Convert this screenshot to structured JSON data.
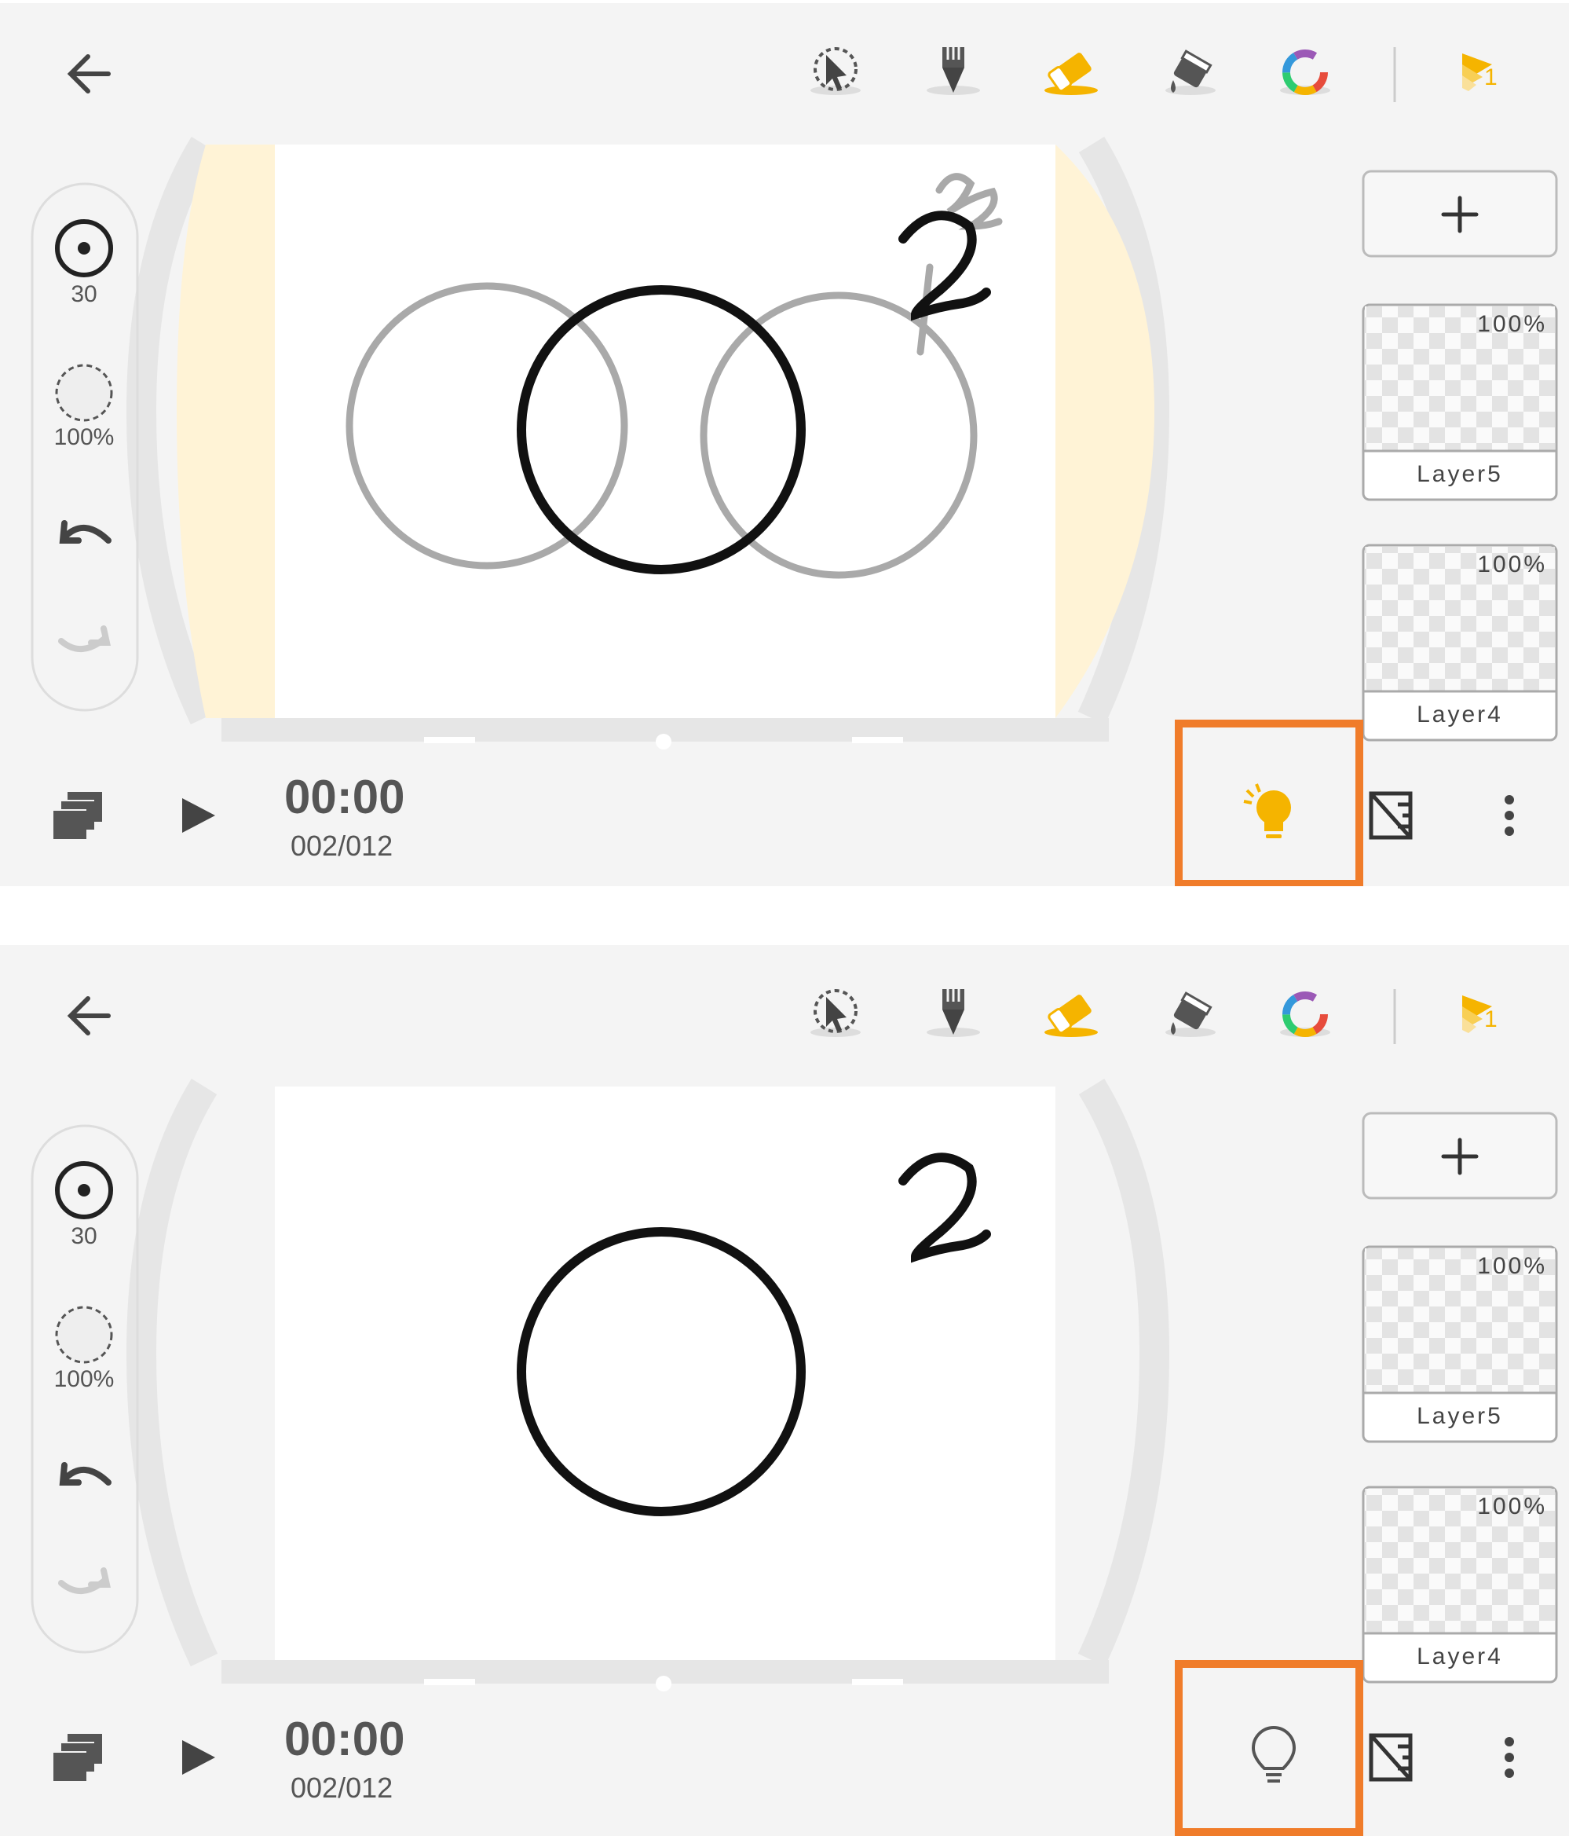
{
  "panels": [
    {
      "id": "top",
      "sidebar": {
        "brush_size": "30",
        "opacity": "100%"
      },
      "layers": [
        {
          "name": "Layer5",
          "opacity": "100%"
        },
        {
          "name": "Layer4",
          "opacity": "100%"
        }
      ],
      "timeline": {
        "time": "00:00",
        "frame": "002/012"
      },
      "onion_skin": {
        "state": "on",
        "color": "#f5b400"
      },
      "layer_badge": "1"
    },
    {
      "id": "bottom",
      "sidebar": {
        "brush_size": "30",
        "opacity": "100%"
      },
      "layers": [
        {
          "name": "Layer5",
          "opacity": "100%"
        },
        {
          "name": "Layer4",
          "opacity": "100%"
        }
      ],
      "timeline": {
        "time": "00:00",
        "frame": "002/012"
      },
      "onion_skin": {
        "state": "off",
        "color": "#555555"
      },
      "layer_badge": "1"
    }
  ],
  "colors": {
    "accent": "#f5b400",
    "highlight": "#f07c2a",
    "onion_tint": "#fff3d6"
  }
}
